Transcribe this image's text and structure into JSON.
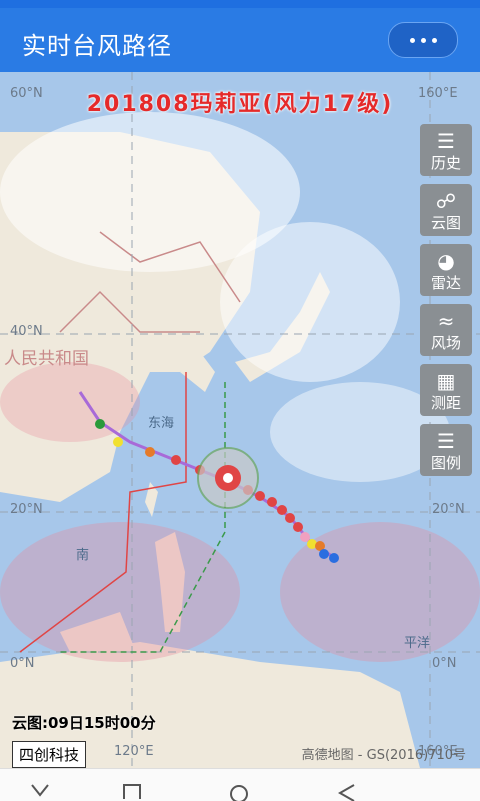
{
  "app": {
    "title": "实时台风路径"
  },
  "storm": {
    "title": "201808玛莉亚(风力17级)"
  },
  "map": {
    "lat_labels": [
      "60°N",
      "40°N",
      "20°N",
      "0°N",
      "160°E",
      "20°N",
      "0°N"
    ],
    "lon_labels": [
      "120°E",
      "160°E"
    ],
    "place_labels": [
      "东海",
      "人民共和国",
      "南",
      "平洋"
    ],
    "cloud_time": "云图:09日15时00分",
    "brand": "四创科技",
    "credit": "高德地图 - GS(2016)710号"
  },
  "tools": [
    {
      "icon": "clipboard-icon",
      "label": "历史"
    },
    {
      "icon": "satellite-icon",
      "label": "云图"
    },
    {
      "icon": "radar-icon",
      "label": "雷达"
    },
    {
      "icon": "wind-icon",
      "label": "风场"
    },
    {
      "icon": "ruler-icon",
      "label": "测距"
    },
    {
      "icon": "list-icon",
      "label": "图例"
    }
  ],
  "colors": {
    "appbar": "#2a7be4",
    "title_red": "#e52a2a",
    "tool_bg": "#8a8f93"
  }
}
